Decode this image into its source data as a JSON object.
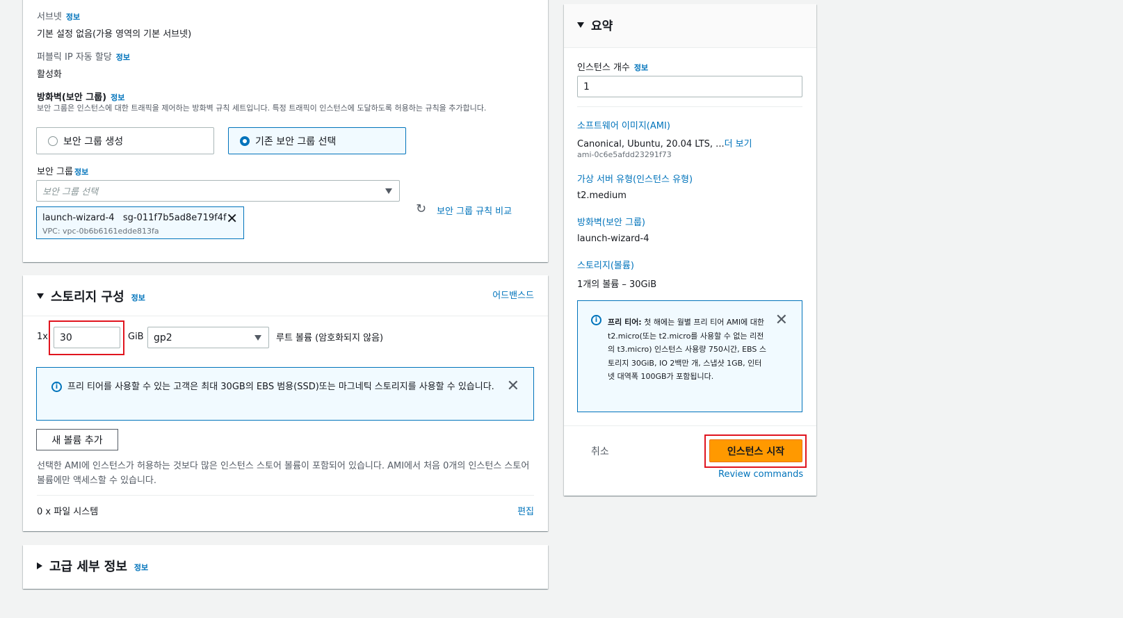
{
  "network": {
    "subnet_label": "서브넷",
    "subnet_info": "정보",
    "subnet_value": "기본 설정 없음(가용 영역의 기본 서브넷)",
    "public_ip_label": "퍼블릭 IP 자동 할당",
    "public_ip_info": "정보",
    "public_ip_value": "활성화",
    "firewall_label": "방화벽(보안 그룹)",
    "firewall_info": "정보",
    "firewall_desc": "보안 그룹은 인스턴스에 대한 트래픽을 제어하는 방화벽 규칙 세트입니다. 특정 트래픽이 인스턴스에 도달하도록 허용하는 규칙을 추가합니다.",
    "radio_create": "보안 그룹 생성",
    "radio_existing": "기존 보안 그룹 선택",
    "sg_label": "보안 그룹",
    "sg_info": "정보",
    "sg_placeholder": "보안 그룹 선택",
    "token_name": "launch-wizard-4",
    "token_id": "sg-011f7b5ad8e719f4f",
    "token_vpc": "VPC: vpc-0b6b6161edde813fa",
    "compare_link": "보안 그룹 규칙 비교"
  },
  "storage": {
    "title": "스토리지 구성",
    "info": "정보",
    "advanced": "어드밴스드",
    "count_prefix": "1x",
    "size_value": "30",
    "unit": "GiB",
    "volume_type": "gp2",
    "root_desc": "루트 볼륨  (암호화되지 않음)",
    "freetier_text": "프리 티어를 사용할 수 있는 고객은 최대 30GB의 EBS 범용(SSD)또는 마그네틱 스토리지를 사용할 수 있습니다.",
    "add_volume": "새 볼륨 추가",
    "ami_note": "선택한 AMI에 인스턴스가 허용하는 것보다 많은 인스턴스 스토어 볼륨이 포함되어 있습니다. AMI에서 처음 0개의 인스턴스 스토어 볼륨에만 액세스할 수 있습니다.",
    "filesystem": "0 x 파일 시스템",
    "edit": "편집"
  },
  "advanced": {
    "title": "고급 세부 정보",
    "info": "정보"
  },
  "summary": {
    "title": "요약",
    "count_label": "인스턴스 개수",
    "count_info": "정보",
    "count_value": "1",
    "ami_link": "소프트웨어 이미지(AMI)",
    "ami_value": "Canonical, Ubuntu, 20.04 LTS, ...",
    "ami_more": "더 보기",
    "ami_id": "ami-0c6e5afdd23291f73",
    "type_link": "가상 서버 유형(인스턴스 유형)",
    "type_value": "t2.medium",
    "fw_link": "방화벽(보안 그룹)",
    "fw_value": "launch-wizard-4",
    "storage_link": "스토리지(볼륨)",
    "storage_value": "1개의 볼륨 – 30GiB",
    "freetier_bold": "프리 티어:",
    "freetier_text": " 첫 해에는 월별 프리 티어 AMI에 대한 t2.micro(또는 t2.micro를 사용할 수 없는 리전의 t3.micro) 인스턴스 사용량 750시간, EBS 스토리지 30GiB, IO 2백만 개, 스냅샷 1GB, 인터넷 대역폭 100GB가 포함됩니다.",
    "cancel": "취소",
    "launch": "인스턴스 시작",
    "review": "Review commands"
  },
  "colors": {
    "accent": "#0073bb",
    "launch_button": "#ff9900",
    "highlight": "#e0141e"
  }
}
